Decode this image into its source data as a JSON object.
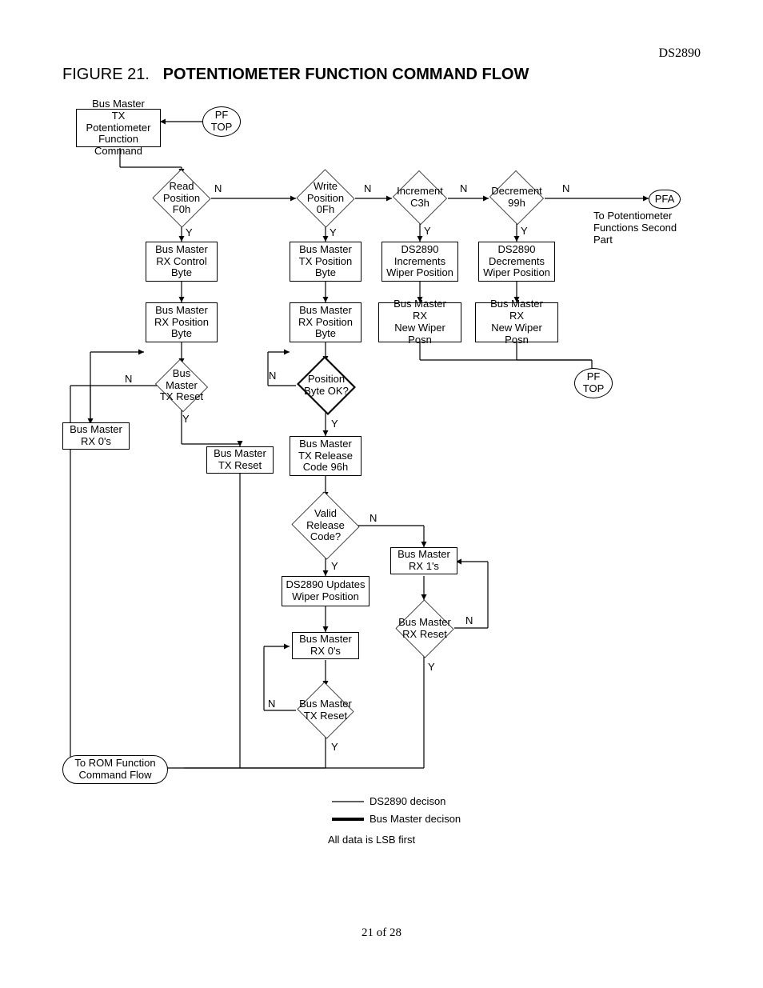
{
  "doc": {
    "device": "DS2890",
    "page": "21 of 28"
  },
  "title": {
    "fig": "FIGURE 21.",
    "caption": "POTENTIOMETER FUNCTION COMMAND FLOW"
  },
  "nodes": {
    "pf_top_1": "PF\nTOP",
    "pf_top_2": "PF\nTOP",
    "pfa": "PFA",
    "pfa_note": "To Potentiometer\nFunctions Second Part",
    "tx_func_cmd": "Bus Master\nTX Potentiometer\nFunction Command",
    "read_pos": "Read\nPosition\nF0h",
    "write_pos": "Write\nPosition\n0Fh",
    "incr": "Increment\nC3h",
    "decr": "Decrement\n99h",
    "rx_ctrl": "Bus Master\nRX Control\nByte",
    "tx_pos": "Bus Master\nTX Position\nByte",
    "ds_incr": "DS2890\nIncrements\nWiper Position",
    "ds_decr": "DS2890\nDecrements\nWiper Position",
    "rx_pos_a": "Bus Master\nRX Position\nByte",
    "rx_pos_b": "Bus Master\nRX Position\nByte",
    "rx_new_a": "Bus Master\nRX\nNew Wiper Posn",
    "rx_new_b": "Bus Master\nRX\nNew Wiper Posn",
    "tx_reset_a": "Bus Master\nTX Reset",
    "pos_ok": "Position\nByte OK?",
    "rx0_a": "Bus Master\nRX 0's",
    "tx_reset_b": "Bus Master\nTX Reset",
    "tx_release": "Bus Master\nTX Release\nCode 96h",
    "valid_rel": "Valid\nRelease Code?",
    "rx1": "Bus Master\nRX 1's",
    "ds_update": "DS2890 Updates\nWiper Position",
    "rx_reset": "Bus Master\nRX Reset",
    "rx0_b": "Bus Master\nRX 0's",
    "tx_reset_c": "Bus Master\nTX Reset",
    "to_rom": "To ROM Function\nCommand Flow"
  },
  "labels": {
    "Y": "Y",
    "N": "N"
  },
  "legend": {
    "thin": "DS2890 decison",
    "thick": "Bus Master decison",
    "note": "All data is LSB first"
  }
}
